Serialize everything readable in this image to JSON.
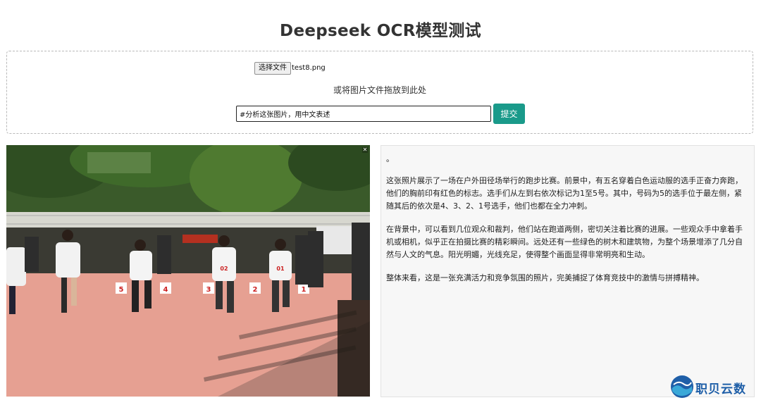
{
  "page": {
    "title": "Deepseek OCR模型测试"
  },
  "upload": {
    "file_button_label": "选择文件",
    "file_name": "test8.png",
    "drop_hint": "或将图片文件拖放到此处",
    "prompt_value": "#分析这张图片，用中文表述",
    "submit_label": "提交"
  },
  "photo": {
    "close_glyph": "✕",
    "bibs": [
      "5",
      "4",
      "3",
      "2",
      "1"
    ],
    "bib_runners": [
      "02",
      "01"
    ]
  },
  "result": {
    "paragraphs": [
      "。",
      "这张照片展示了一场在户外田径场举行的跑步比赛。前景中，有五名穿着白色运动服的选手正奋力奔跑，他们的胸前印有红色的标志。选手们从左到右依次标记为1至5号。其中，号码为5的选手位于最左侧，紧随其后的依次是4、3、2、1号选手，他们也都在全力冲刺。",
      "在背景中，可以看到几位观众和裁判，他们站在跑道两侧，密切关注着比赛的进展。一些观众手中拿着手机或相机，似乎正在拍摄比赛的精彩瞬间。远处还有一些绿色的树木和建筑物，为整个场景增添了几分自然与人文的气息。阳光明媚，光线充足，使得整个画面显得非常明亮和生动。",
      "整体来看，这是一张充满活力和竞争氛围的照片，完美捕捉了体育竞技中的激情与拼搏精神。"
    ]
  },
  "watermark": {
    "text": "职贝云数"
  },
  "colors": {
    "accent": "#1a9a8a",
    "track": "#e9a090",
    "watermark": "#1f5fa8"
  }
}
